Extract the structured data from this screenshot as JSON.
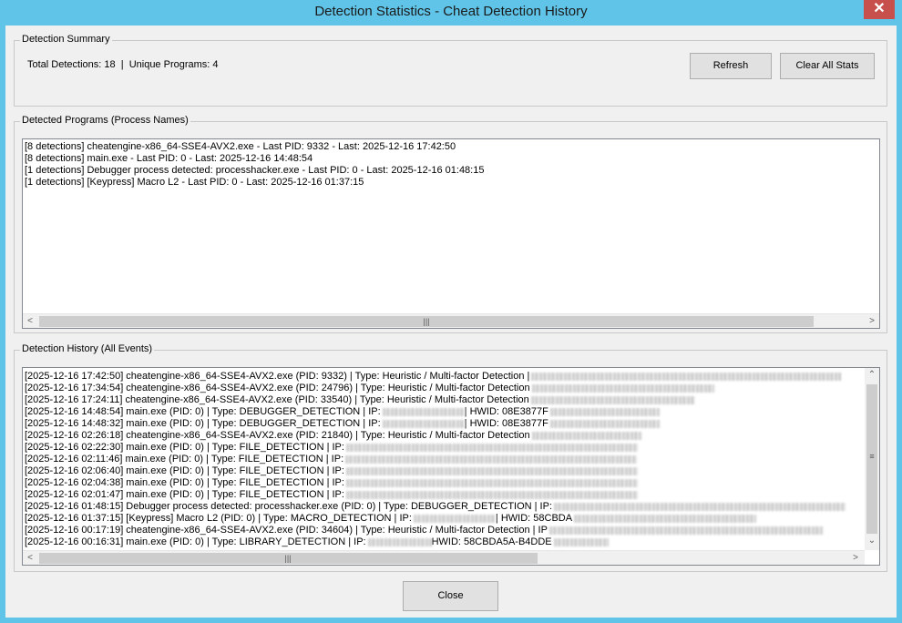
{
  "window": {
    "title": "Detection Statistics - Cheat Detection History",
    "close_glyph": "✕"
  },
  "summary": {
    "legend": "Detection Summary",
    "text": "Total Detections: 18  |  Unique Programs: 4",
    "refresh_label": "Refresh",
    "clear_label": "Clear All Stats"
  },
  "programs": {
    "legend": "Detected Programs (Process Names)",
    "items": [
      "[8 detections] cheatengine-x86_64-SSE4-AVX2.exe - Last PID: 9332 - Last: 2025-12-16 17:42:50",
      "[8 detections] main.exe - Last PID: 0 - Last: 2025-12-16 14:48:54",
      "[1 detections] Debugger process detected: processhacker.exe - Last PID: 0 - Last: 2025-12-16 01:48:15",
      "[1 detections] [Keypress] Macro L2 - Last PID: 0 - Last: 2025-12-16 01:37:15"
    ]
  },
  "history": {
    "legend": "Detection History (All Events)",
    "items": [
      "[2025-12-16 17:42:50] cheatengine-x86_64-SSE4-AVX2.exe (PID: 9332) | Type: Heuristic / Multi-factor Detection |",
      "[2025-12-16 17:34:54] cheatengine-x86_64-SSE4-AVX2.exe (PID: 24796) | Type: Heuristic / Multi-factor Detection",
      "[2025-12-16 17:24:11] cheatengine-x86_64-SSE4-AVX2.exe (PID: 33540) | Type: Heuristic / Multi-factor Detection",
      "[2025-12-16 14:48:54] main.exe (PID: 0) | Type: DEBUGGER_DETECTION | IP:",
      "[2025-12-16 14:48:32] main.exe (PID: 0) | Type: DEBUGGER_DETECTION | IP:",
      "[2025-12-16 02:26:18] cheatengine-x86_64-SSE4-AVX2.exe (PID: 21840) | Type: Heuristic / Multi-factor Detection",
      "[2025-12-16 02:22:30] main.exe (PID: 0) | Type: FILE_DETECTION | IP:",
      "[2025-12-16 02:11:46] main.exe (PID: 0) | Type: FILE_DETECTION | IP:",
      "[2025-12-16 02:06:40] main.exe (PID: 0) | Type: FILE_DETECTION | IP:",
      "[2025-12-16 02:04:38] main.exe (PID: 0) | Type: FILE_DETECTION | IP:",
      "[2025-12-16 02:01:47] main.exe (PID: 0) | Type: FILE_DETECTION | IP:",
      "[2025-12-16 01:48:15] Debugger process detected: processhacker.exe (PID: 0) | Type: DEBUGGER_DETECTION | IP:",
      "[2025-12-16 01:37:15] [Keypress] Macro L2 (PID: 0) | Type: MACRO_DETECTION | IP:",
      "[2025-12-16 00:17:19] cheatengine-x86_64-SSE4-AVX2.exe (PID: 34604) | Type: Heuristic / Multi-factor Detection | IP",
      "[2025-12-16 00:16:31] main.exe (PID: 0) | Type: LIBRARY_DETECTION | IP:"
    ],
    "hwid_fragments": [
      "",
      "",
      "",
      "| HWID: 08E3877F",
      "| HWID: 08E3877F",
      "",
      "",
      "",
      "",
      "",
      "",
      "",
      "| HWID: 58CBDA",
      "",
      "HWID: 58CBDA5A-B4DDE"
    ]
  },
  "footer": {
    "close_label": "Close"
  }
}
